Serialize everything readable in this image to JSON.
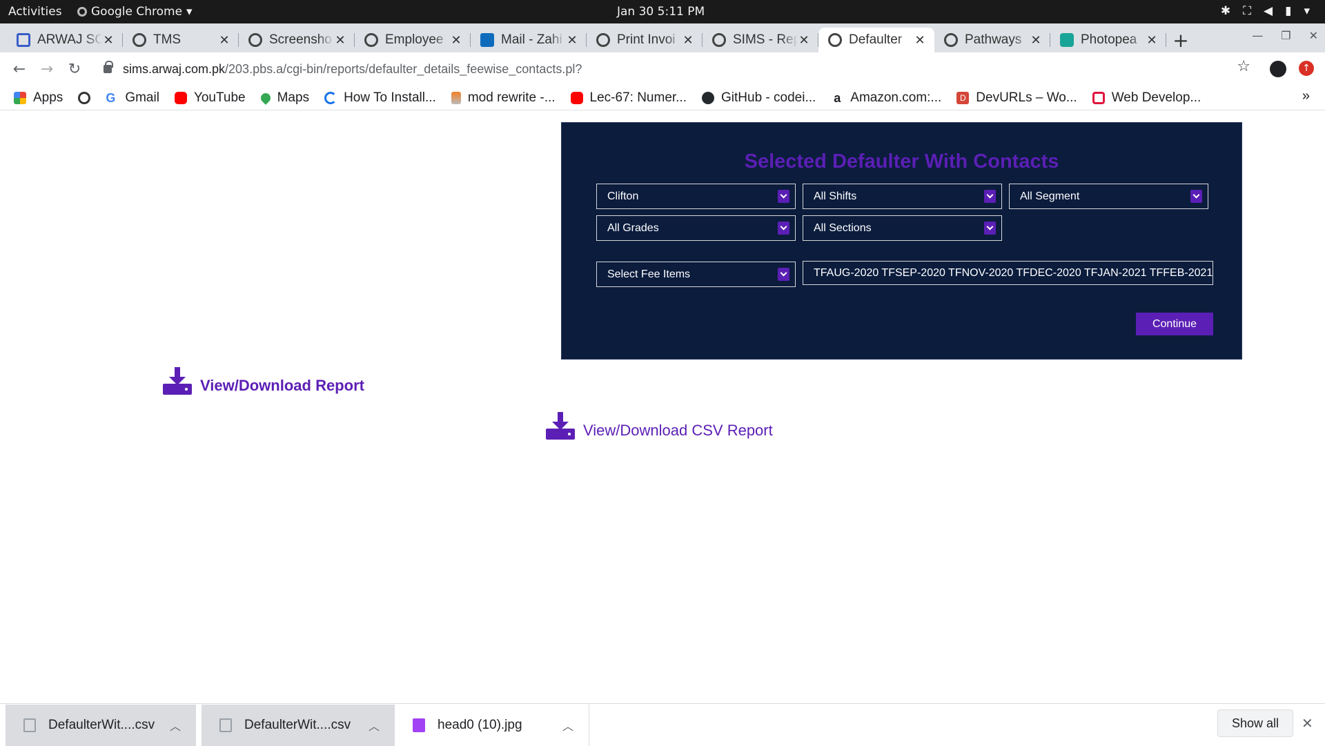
{
  "system": {
    "activities": "Activities",
    "app_name": "Google Chrome",
    "clock": "Jan 30   5:11 PM"
  },
  "tabs": [
    {
      "title": "ARWAJ SC",
      "icon": "arwaj-icon"
    },
    {
      "title": "TMS",
      "icon": "globe-icon"
    },
    {
      "title": "Screensho",
      "icon": "globe-icon"
    },
    {
      "title": "Employee",
      "icon": "globe-icon"
    },
    {
      "title": "Mail - Zahi",
      "icon": "outlook-icon"
    },
    {
      "title": "Print Invoi",
      "icon": "globe-icon"
    },
    {
      "title": "SIMS - Rep",
      "icon": "globe-icon"
    },
    {
      "title": "Defaulter",
      "icon": "globe-icon",
      "active": true
    },
    {
      "title": "Pathways",
      "icon": "globe-icon"
    },
    {
      "title": "Photopea",
      "icon": "photopea-icon"
    }
  ],
  "address": {
    "host": "sims.arwaj.com.pk",
    "path": "/203.pbs.a/cgi-bin/reports/defaulter_details_feewise_contacts.pl?"
  },
  "bookmarks": [
    {
      "label": "Apps",
      "icon": "apps-grid-icon"
    },
    {
      "label": "",
      "icon": "globe-icon"
    },
    {
      "label": "Gmail",
      "icon": "google-icon"
    },
    {
      "label": "YouTube",
      "icon": "youtube-icon"
    },
    {
      "label": "Maps",
      "icon": "maps-icon"
    },
    {
      "label": "How To Install...",
      "icon": "loader-icon"
    },
    {
      "label": "mod rewrite -...",
      "icon": "stackoverflow-icon"
    },
    {
      "label": "Lec-67: Numer...",
      "icon": "youtube-icon"
    },
    {
      "label": "GitHub - codei...",
      "icon": "github-icon"
    },
    {
      "label": "Amazon.com:...",
      "icon": "amazon-icon"
    },
    {
      "label": "DevURLs – Wo...",
      "icon": "devurls-icon"
    },
    {
      "label": "Web Develop...",
      "icon": "web-dev-icon"
    }
  ],
  "form": {
    "title": "Selected Defaulter With Contacts",
    "campus": "Clifton",
    "shift": "All Shifts",
    "segment": "All Segment",
    "grade": "All Grades",
    "section": "All Sections",
    "fee_items_select": "Select Fee Items",
    "fee_items_value": "TFAUG-2020 TFSEP-2020 TFNOV-2020 TFDEC-2020 TFJAN-2021 TFFEB-2021",
    "continue_label": "Continue"
  },
  "links": {
    "report": "View/Download Report",
    "csv_report": "View/Download CSV Report"
  },
  "downloads": [
    {
      "name": "DefaulterWit....csv"
    },
    {
      "name": "DefaulterWit....csv"
    },
    {
      "name": "head0 (10).jpg"
    }
  ],
  "shelf": {
    "show_all": "Show all"
  },
  "colors": {
    "panel_bg": "#0b1c3d",
    "accent": "#5b1fb5"
  }
}
